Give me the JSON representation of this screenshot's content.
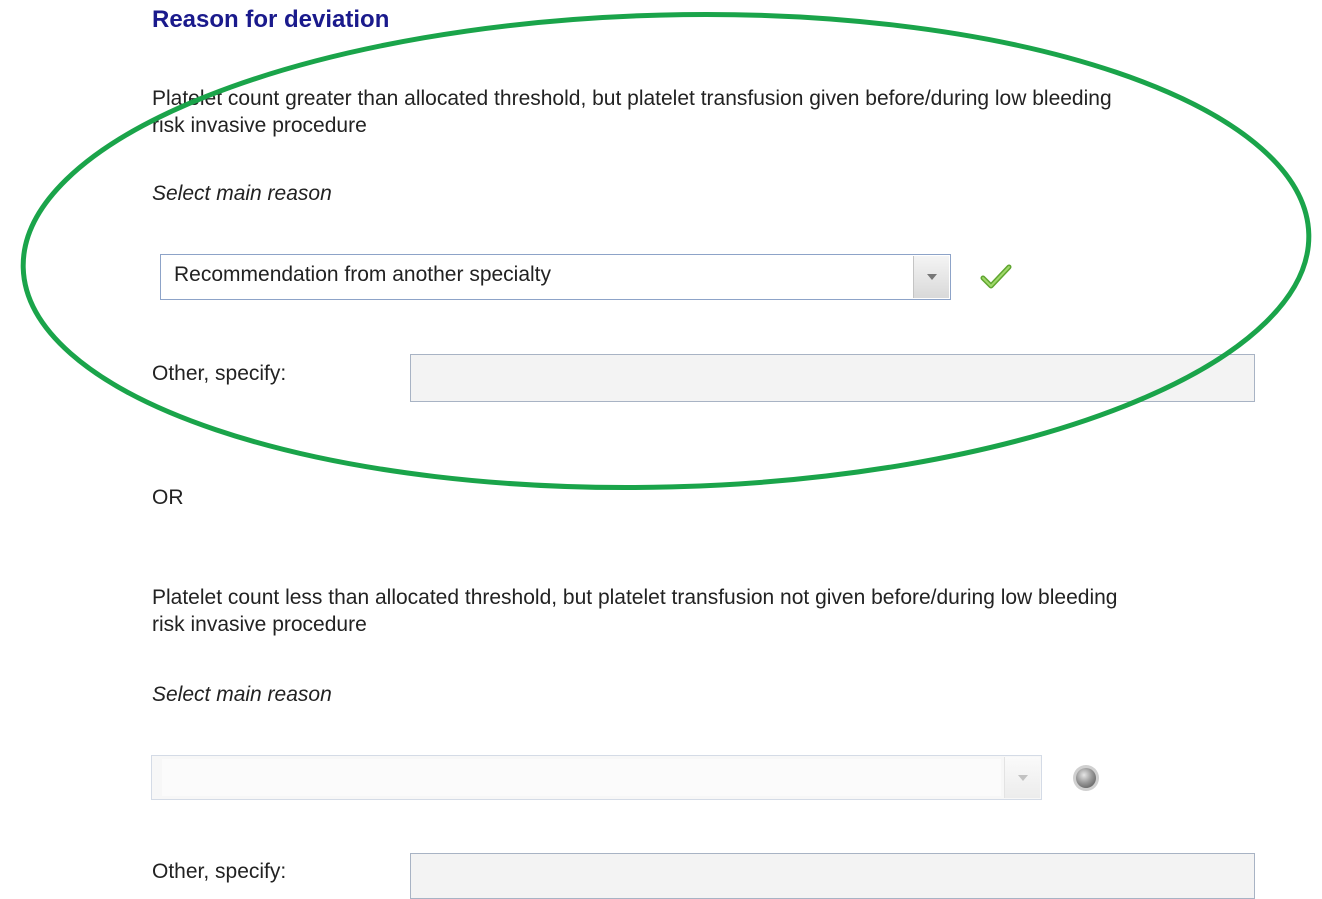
{
  "section_title": "Reason for deviation",
  "block1": {
    "description": "Platelet count greater than allocated threshold, but platelet transfusion given before/during low bleeding risk invasive procedure",
    "select_prompt": "Select main reason",
    "selected_value": "Recommendation from another specialty",
    "status_icon": "check-icon",
    "other_label": "Other, specify:",
    "other_value": ""
  },
  "or_text": "OR",
  "block2": {
    "description": "Platelet count less than allocated threshold, but platelet transfusion not given before/during low bleeding risk invasive procedure",
    "select_prompt": "Select main reason",
    "selected_value": "",
    "status_icon": "grey-circle-icon",
    "other_label": "Other, specify:",
    "other_value": ""
  },
  "annotation": {
    "shape": "ellipse",
    "color": "#1aa44a"
  }
}
